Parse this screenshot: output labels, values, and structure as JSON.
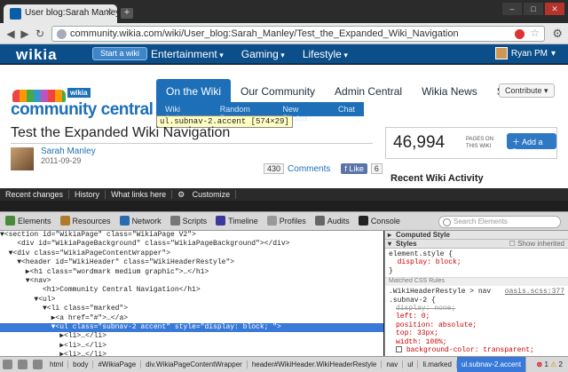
{
  "browser": {
    "tab_title": "User blog:Sarah Manley/Te",
    "url": "community.wikia.com/wiki/User_blog:Sarah_Manley/Test_the_Expanded_Wiki_Navigation"
  },
  "wikia_header": {
    "logo": "wikia",
    "start_wiki": "Start a wiki",
    "nav": [
      "Entertainment",
      "Gaming",
      "Lifestyle"
    ],
    "user": "Ryan PM"
  },
  "site": {
    "badge": "wikia",
    "name": "community central",
    "tabs": [
      "On the Wiki",
      "Our Community",
      "Admin Central",
      "Wikia News",
      "Support"
    ],
    "contribute": "Contribute",
    "subtabs": [
      "Wiki Activity",
      "Random Page",
      "New Photos",
      "Chat"
    ]
  },
  "inspector_tooltip": "ul.subnav-2.accent [574×29]",
  "article": {
    "title": "Test the Expanded Wiki Navigation",
    "author": "Sarah Manley",
    "date": "2011-09-29",
    "comment_count": "430",
    "comments_label": "Comments",
    "like_label": "Like",
    "like_count": "6"
  },
  "rail": {
    "page_count": "46,994",
    "page_count_label": "PAGES ON THIS WIKI",
    "add_page": "Add a Page",
    "recent_activity": "Recent Wiki Activity"
  },
  "article_bar": [
    "Recent changes",
    "History",
    "What links here",
    "Customize"
  ],
  "devtools": {
    "tools": [
      "Elements",
      "Resources",
      "Network",
      "Scripts",
      "Timeline",
      "Profiles",
      "Audits",
      "Console"
    ],
    "search_placeholder": "Search Elements",
    "dom": [
      "▼<section id=\"WikiaPage\" class=\"WikiaPage V2\">",
      "    <div id=\"WikiaPageBackground\" class=\"WikiaPageBackground\"></div>",
      "  ▼<div class=\"WikiaPageContentWrapper\">",
      "    ▼<header id=\"WikiHeader\" class=\"WikiHeaderRestyle\">",
      "      ▶<h1 class=\"wordmark medium graphic\">…</h1>",
      "      ▼<nav>",
      "          <h1>Community Central Navigation</h1>",
      "        ▼<ul>",
      "          ▼<li class=\"marked\">",
      "            ▶<a href=\"#\">…</a>",
      "            ▼<ul class=\"subnav-2 accent\" style=\"display: block; \">",
      "              ▶<li>…</li>",
      "              ▶<li>…</li>",
      "              ▶<li>…</li>"
    ],
    "selected_dom_line": 10,
    "computed_style": "Computed Style",
    "show_inherited": "Show inherited",
    "styles": "Styles",
    "element_style": [
      "element.style {",
      "  display: block;",
      "}"
    ],
    "matched_rules": "Matched CSS Rules",
    "rule_selector": ".WikiHeaderRestyle > nav",
    "rule_selector2": ".subnav-2 {",
    "rule_source": "oasis.scss:377",
    "rule_props": [
      "display: none;",
      "left: 0;",
      "position: absolute;",
      "top: 33px;",
      "width: 100%;",
      "background-color: transparent;"
    ],
    "breadcrumbs": [
      "html",
      "body",
      "#WikiaPage",
      "div.WikiaPageContentWrapper",
      "header#WikiHeader.WikiHeaderRestyle",
      "nav",
      "ul",
      "li.marked",
      "ul.subnav-2.accent"
    ],
    "error_count": "1",
    "warning_count": "2"
  }
}
